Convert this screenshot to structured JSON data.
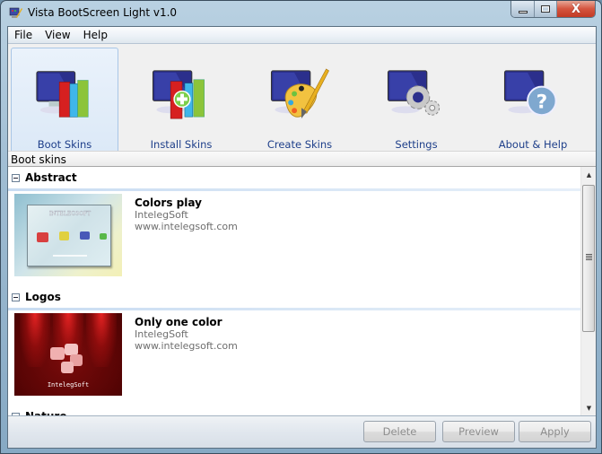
{
  "window": {
    "title": "Vista BootScreen Light v1.0",
    "caption_buttons": {
      "minimize": "minimize",
      "maximize": "maximize",
      "close": "X"
    }
  },
  "menu": {
    "items": [
      {
        "label": "File"
      },
      {
        "label": "View"
      },
      {
        "label": "Help"
      }
    ]
  },
  "toolbar": {
    "items": [
      {
        "label": "Boot Skins",
        "icon": "monitor-books-icon",
        "active": true
      },
      {
        "label": "Install Skins",
        "icon": "monitor-books-plus-icon",
        "active": false
      },
      {
        "label": "Create Skins",
        "icon": "monitor-palette-icon",
        "active": false
      },
      {
        "label": "Settings",
        "icon": "monitor-gears-icon",
        "active": false
      },
      {
        "label": "About & Help",
        "icon": "monitor-help-icon",
        "active": false
      }
    ]
  },
  "section": {
    "title": "Boot skins"
  },
  "groups": [
    {
      "title": "Abstract",
      "items": [
        {
          "name": "Colors play",
          "author": "IntelegSoft",
          "url": "www.intelegsoft.com",
          "thumb_caption": "INTELEGSOFT"
        }
      ]
    },
    {
      "title": "Logos",
      "items": [
        {
          "name": "Only one color",
          "author": "IntelegSoft",
          "url": "www.intelegsoft.com",
          "thumb_caption": "IntelegSoft"
        }
      ]
    },
    {
      "title": "Nature",
      "items": []
    }
  ],
  "actions": {
    "delete": "Delete",
    "preview": "Preview",
    "apply": "Apply"
  },
  "colors": {
    "toolbar_label": "#1e3f8a",
    "active_tool_bg": "#dce9f7",
    "close_button": "#c23a24",
    "disabled_text": "#8d8d8d"
  }
}
